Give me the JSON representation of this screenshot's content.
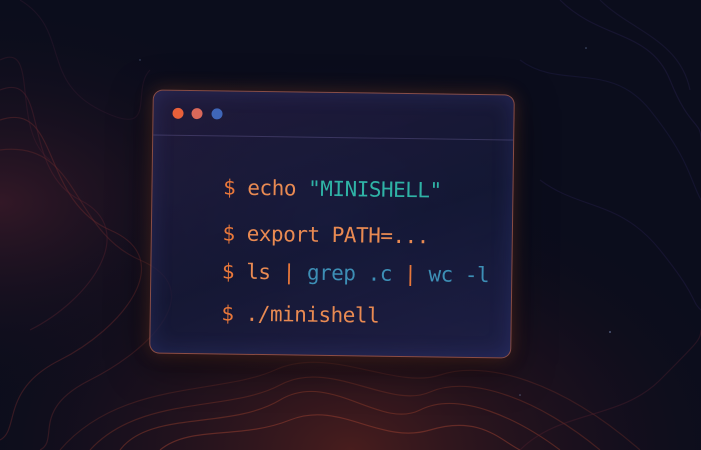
{
  "colors": {
    "background": "#0b0d1c",
    "prompt": "#e8773a",
    "command": "#e98a52",
    "string": "#2fb3a6",
    "pipe_arg": "#3d8fb6",
    "pipe_symbol": "#e8773a",
    "dot_red": "#e8603a",
    "dot_orange": "#d9685a",
    "dot_blue": "#3f66b8"
  },
  "window": {
    "controls": [
      "close-dot",
      "minimize-dot",
      "maximize-dot"
    ]
  },
  "terminal": {
    "line1": {
      "prompt": "$",
      "cmd": "echo",
      "arg": "\"MINISHELL\""
    },
    "line2": {
      "prompt": "$",
      "cmd": "export PATH=",
      "arg": "..."
    },
    "line3": {
      "prompt": "$",
      "cmd": "ls",
      "pipe1": "|",
      "arg1": "grep .c",
      "pipe2": "|",
      "arg2": "wc -l"
    },
    "line4": {
      "prompt": "$",
      "cmd": "./minishell"
    }
  }
}
